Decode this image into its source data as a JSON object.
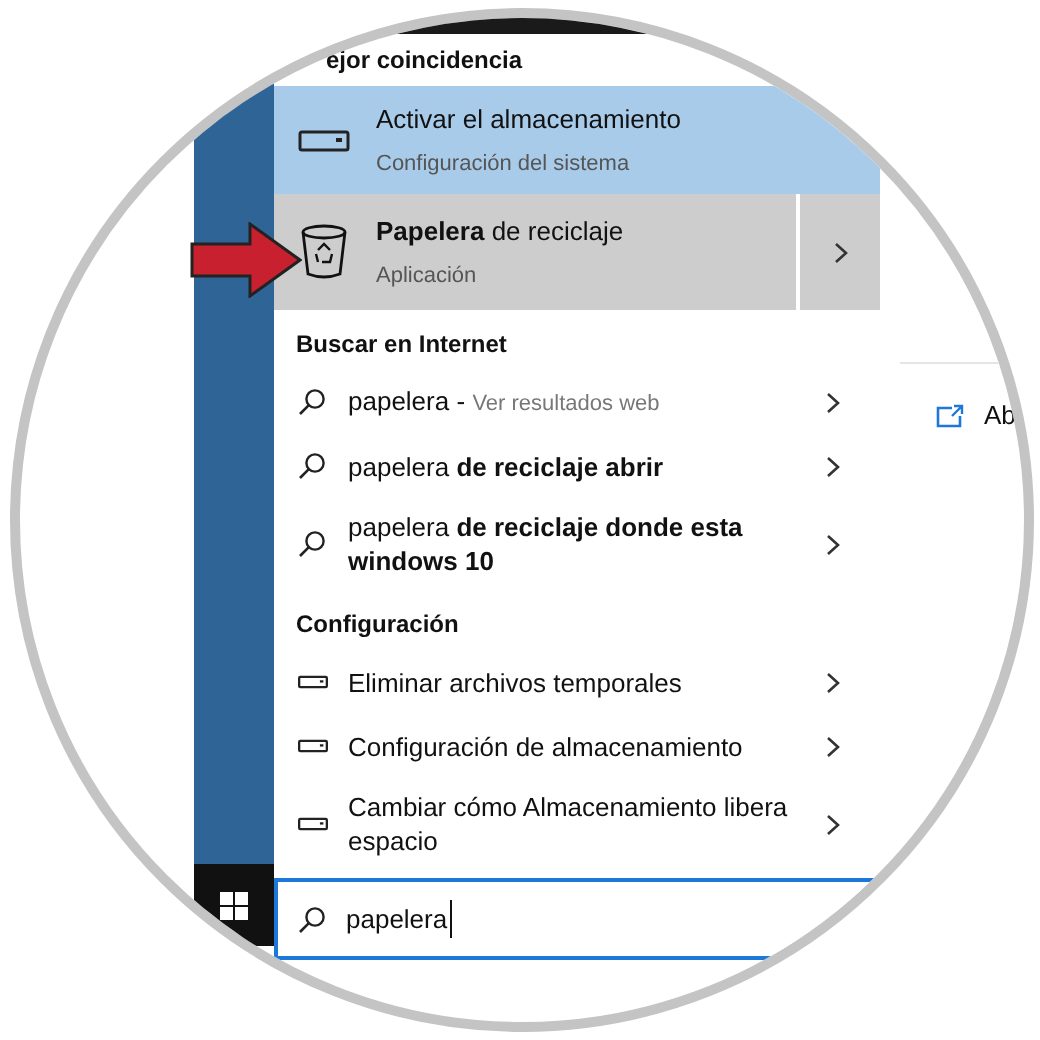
{
  "best_match": {
    "heading": "ejor coincidencia",
    "items": [
      {
        "kind": "setting",
        "title": "Activar el almacenamiento",
        "subtitle": "Configuración del sistema",
        "selected": true,
        "has_arrow": false
      },
      {
        "kind": "app",
        "title": "**Papelera** de reciclaje",
        "subtitle": "Aplicación",
        "selected": false,
        "has_arrow": true
      }
    ]
  },
  "sections": [
    {
      "heading": "Buscar en Internet",
      "items": [
        {
          "kind": "web",
          "text": "papelera",
          "separator": "-",
          "hint": "Ver resultados web"
        },
        {
          "kind": "web",
          "text": "papelera **de reciclaje abrir**"
        },
        {
          "kind": "web",
          "text": "papelera **de reciclaje donde esta windows 10**"
        }
      ]
    },
    {
      "heading": "Configuración",
      "items": [
        {
          "kind": "setting",
          "text": "Eliminar archivos temporales"
        },
        {
          "kind": "setting",
          "text": "Configuración de almacenamiento"
        },
        {
          "kind": "setting",
          "text": "Cambiar cómo Almacenamiento libera espacio"
        }
      ]
    }
  ],
  "search": {
    "value": "papelera"
  },
  "side_panel": {
    "text": "Ab"
  }
}
